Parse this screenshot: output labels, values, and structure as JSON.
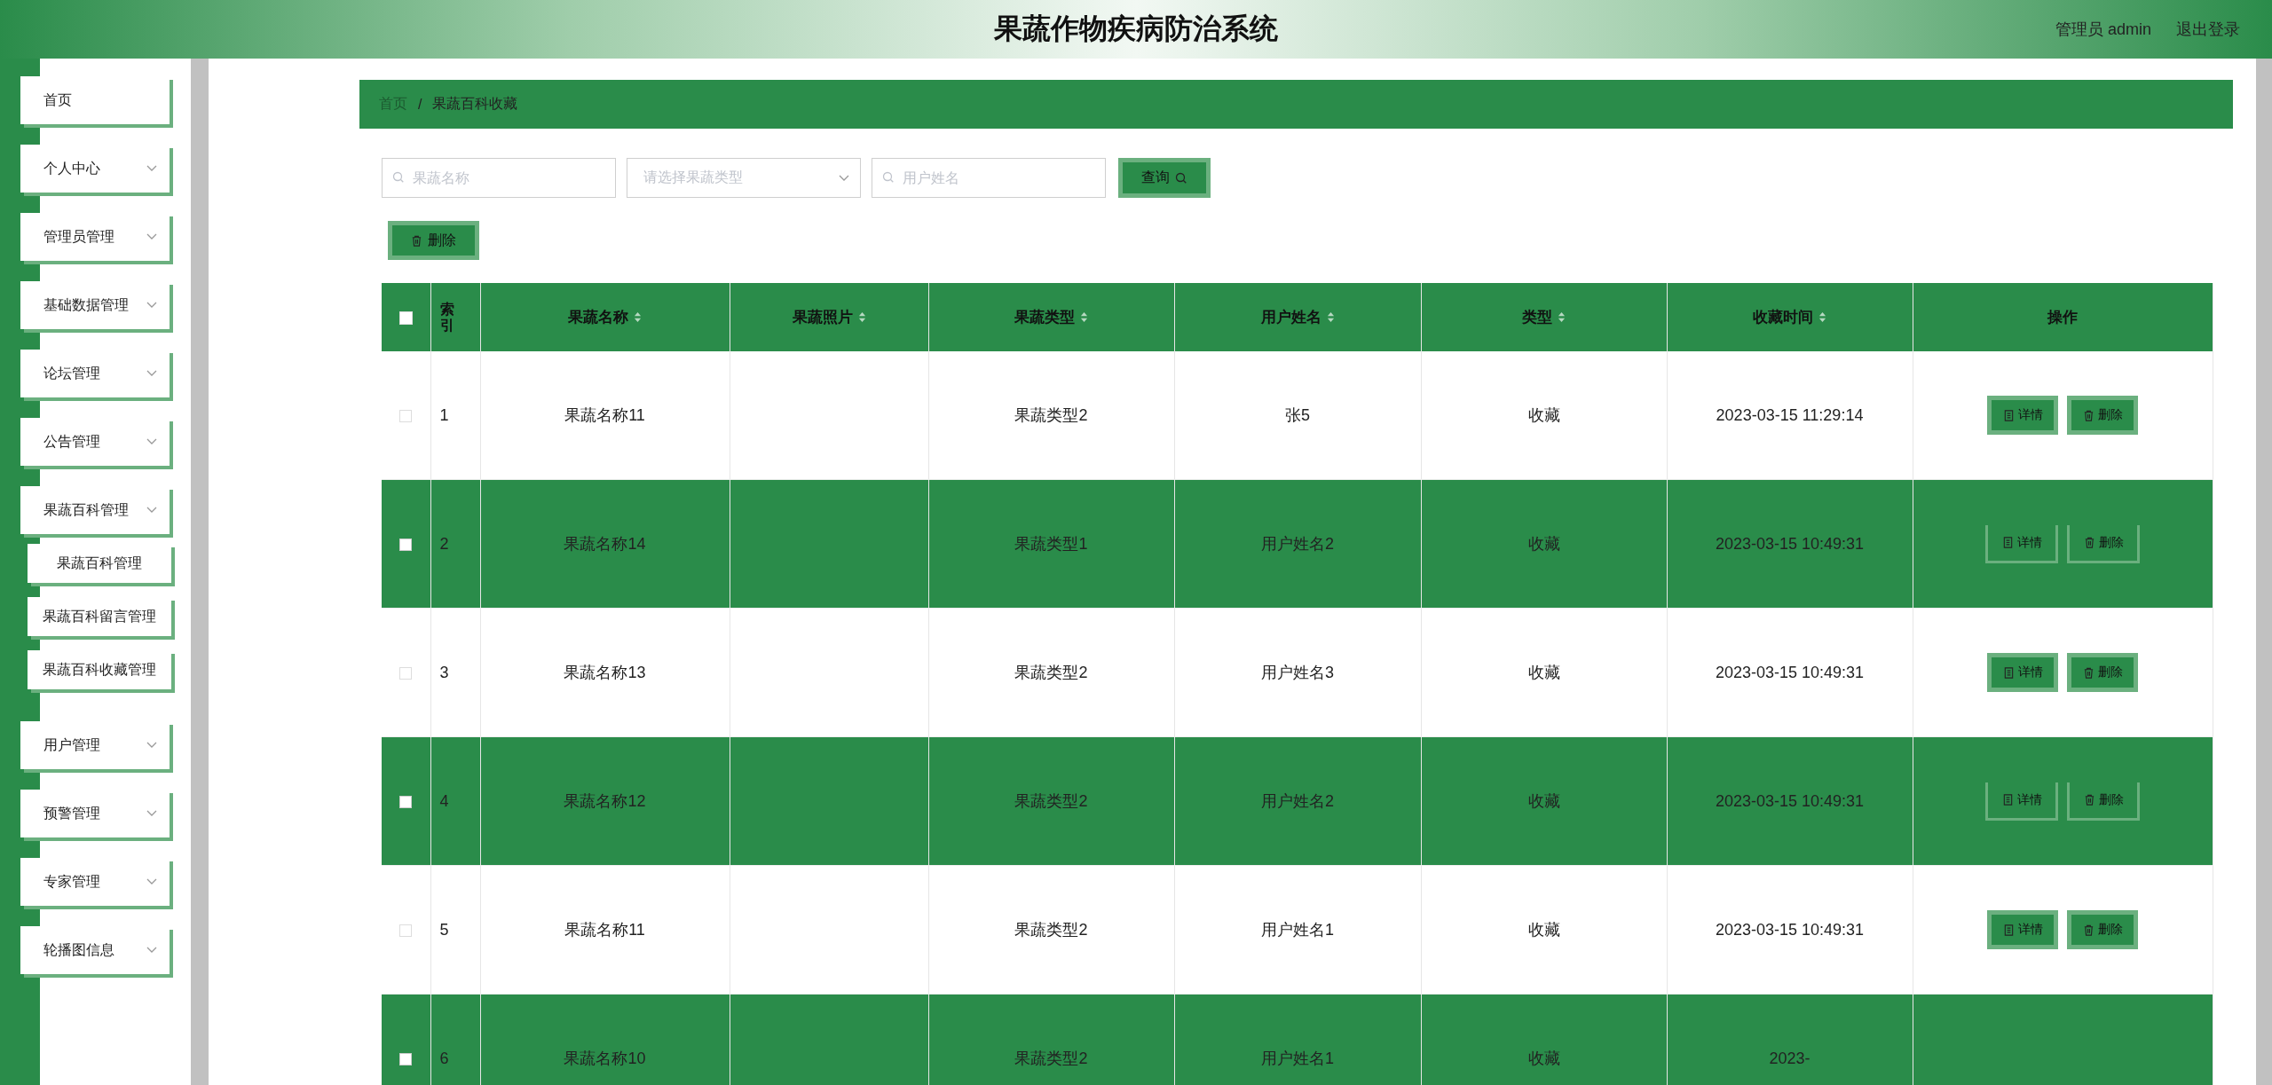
{
  "header": {
    "title": "果蔬作物疾病防治系统",
    "user": "管理员 admin",
    "logout": "退出登录"
  },
  "sidebar": {
    "items": [
      {
        "label": "首页",
        "kind": "link"
      },
      {
        "label": "个人中心",
        "kind": "menu"
      },
      {
        "label": "管理员管理",
        "kind": "menu"
      },
      {
        "label": "基础数据管理",
        "kind": "menu"
      },
      {
        "label": "论坛管理",
        "kind": "menu"
      },
      {
        "label": "公告管理",
        "kind": "menu"
      },
      {
        "label": "果蔬百科管理",
        "kind": "menu",
        "children": [
          {
            "label": "果蔬百科管理"
          },
          {
            "label": "果蔬百科留言管理"
          },
          {
            "label": "果蔬百科收藏管理"
          }
        ]
      },
      {
        "label": "用户管理",
        "kind": "menu"
      },
      {
        "label": "预警管理",
        "kind": "menu"
      },
      {
        "label": "专家管理",
        "kind": "menu"
      },
      {
        "label": "轮播图信息",
        "kind": "menu"
      }
    ]
  },
  "breadcrumb": [
    "首页",
    "/",
    "果蔬百科收藏"
  ],
  "search": {
    "name": {
      "placeholder": "果蔬名称"
    },
    "type": {
      "placeholder": "请选择果蔬类型"
    },
    "user": {
      "placeholder": "用户姓名"
    },
    "button": "查询"
  },
  "delete_button": "删除",
  "table": {
    "select_all": {
      "checked": false
    },
    "columns": [
      {
        "label": "索引",
        "sortable": false
      },
      {
        "label": "果蔬名称",
        "sortable": true
      },
      {
        "label": "果蔬照片",
        "sortable": true
      },
      {
        "label": "果蔬类型",
        "sortable": true
      },
      {
        "label": "用户姓名",
        "sortable": true
      },
      {
        "label": "类型",
        "sortable": true
      },
      {
        "label": "收藏时间",
        "sortable": true
      },
      {
        "label": "操作",
        "sortable": false
      }
    ],
    "rows": [
      {
        "checked": false,
        "index": "1",
        "name": "果蔬名称11",
        "type": "果蔬类型2",
        "user": "张5",
        "kind": "收藏",
        "time": "2023-03-15 11:29:14",
        "actions": [
          "详情",
          "删除"
        ]
      },
      {
        "checked": false,
        "index": "2",
        "name": "果蔬名称14",
        "type": "果蔬类型1",
        "user": "用户姓名2",
        "kind": "收藏",
        "time": "2023-03-15 10:49:31",
        "actions": [
          "详情",
          "删除"
        ]
      },
      {
        "checked": false,
        "index": "3",
        "name": "果蔬名称13",
        "type": "果蔬类型2",
        "user": "用户姓名3",
        "kind": "收藏",
        "time": "2023-03-15 10:49:31",
        "actions": [
          "详情",
          "删除"
        ]
      },
      {
        "checked": false,
        "index": "4",
        "name": "果蔬名称12",
        "type": "果蔬类型2",
        "user": "用户姓名2",
        "kind": "收藏",
        "time": "2023-03-15 10:49:31",
        "actions": [
          "详情",
          "删除"
        ]
      },
      {
        "checked": false,
        "index": "5",
        "name": "果蔬名称11",
        "type": "果蔬类型2",
        "user": "用户姓名1",
        "kind": "收藏",
        "time": "2023-03-15 10:49:31",
        "actions": [
          "详情",
          "删除"
        ]
      },
      {
        "checked": false,
        "index": "6",
        "name": "果蔬名称10",
        "type": "果蔬类型2",
        "user": "用户姓名1",
        "kind": "收藏",
        "time": "2023-"
      }
    ]
  }
}
